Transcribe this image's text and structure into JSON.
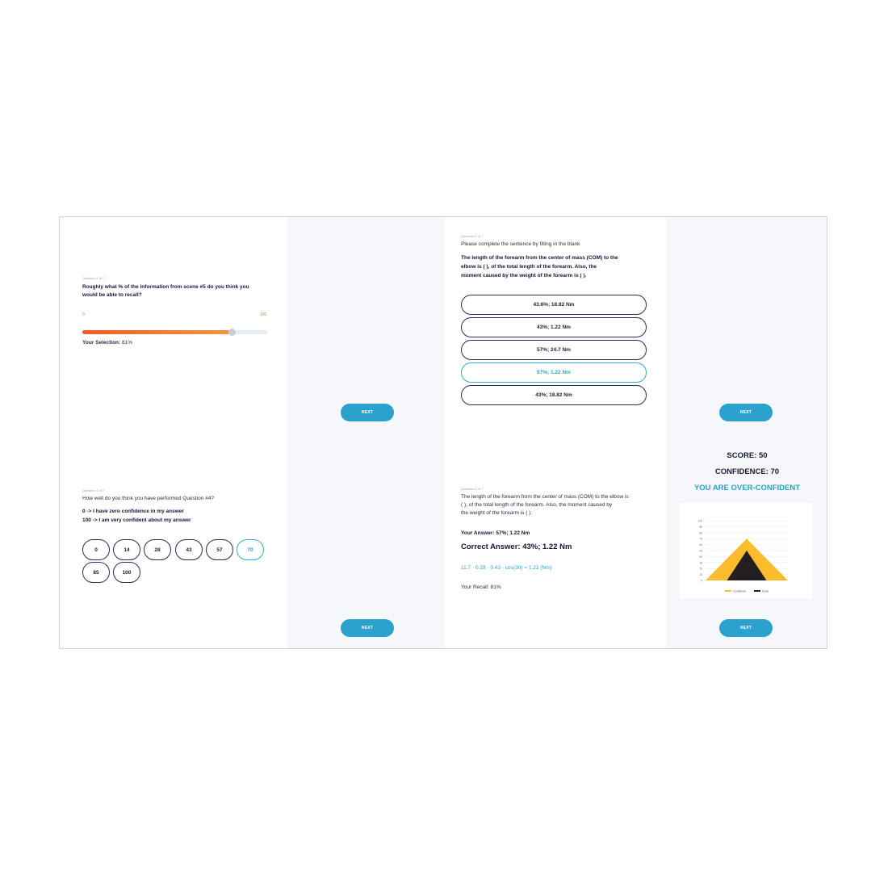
{
  "slider_question": {
    "qnum": "Question 4 of 7",
    "line1": "Roughly what % of the information from scene #5 do you think you",
    "line2": "would be able to recall?",
    "min": "0",
    "max": "100",
    "value_fraction": 0.81,
    "selection_label": "Your Selection:",
    "selection_value": "81%"
  },
  "confidence_question": {
    "qnum": "Question 4 of 7",
    "prompt": "How well do you think you have performed Question #4?",
    "line_low": "0 -> I have zero confidence in my answer",
    "line_high": "100 -> I am very confident about my answer",
    "options": [
      "0",
      "14",
      "28",
      "43",
      "57",
      "70",
      "85",
      "100"
    ],
    "selected": "70"
  },
  "fill_blank_question": {
    "qnum": "Question 4 of 7",
    "instruction": "Please complete the sentence by filling in the blank",
    "line1": "The length of the forearm from the center of mass (COM) to the",
    "line2": "elbow is (            ), of the total length of the forearm. Also, the",
    "line3": "moment caused by the weight of the forearm is (            ).",
    "options": [
      "43.6%; 18.82 Nm",
      "43%; 1.22 Nm",
      "57%; 24.7 Nm",
      "57%; 1.22 Nm",
      "43%; 18.82 Nm"
    ],
    "selected": "57%; 1.22 Nm"
  },
  "answer_review": {
    "qnum": "Question 4 of 7",
    "line1": "The length of the forearm from the center of mass (COM) to the elbow is",
    "line2": "(            ), of the total length of the forearm. Also, the moment caused by",
    "line3": "the weight of the forearm is (            ).",
    "your_answer": "Your Answer: 57%; 1.22 Nm",
    "correct_answer": "Correct Answer: 43%; 1.22 Nm",
    "formula": "11.7 · 0.28 · 0.43 · cos(30) = 1.22 (Nm)",
    "recall": "Your Recall: 81%"
  },
  "result": {
    "score": "SCORE: 50",
    "confidence": "CONFIDENCE: 70",
    "verdict": "YOU ARE OVER-CONFIDENT"
  },
  "next_label": "NEXT",
  "colors": {
    "accent": "#2aa2cd",
    "confidence": "#fbbd2c",
    "score": "#231f20",
    "slider_start": "#f05a24",
    "slider_end": "#f6963a"
  },
  "chart_data": {
    "type": "area",
    "ylim": [
      0,
      100
    ],
    "yticks": [
      0,
      10,
      20,
      30,
      40,
      50,
      60,
      70,
      80,
      90,
      100
    ],
    "series": [
      {
        "name": "Confidence",
        "peak": 70,
        "color": "#fbbd2c"
      },
      {
        "name": "Score",
        "peak": 50,
        "color": "#231f20"
      }
    ],
    "legend": "bottom"
  }
}
